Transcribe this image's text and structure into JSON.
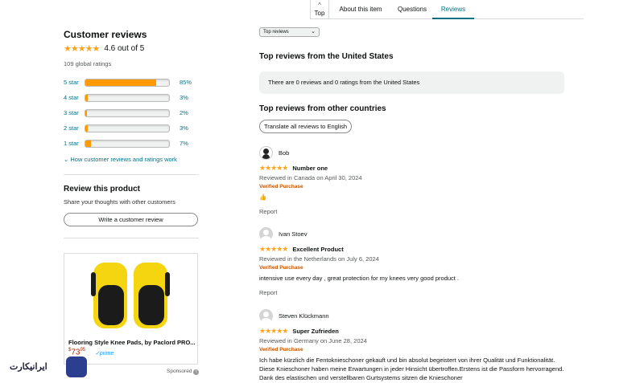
{
  "nav": {
    "top_arrow": "^",
    "top_label": "Top",
    "about": "About this item",
    "questions": "Questions",
    "reviews": "Reviews",
    "active_color": "#007185"
  },
  "summary": {
    "title": "Customer reviews",
    "stars_display": "★★★★★",
    "rating_text": "4.6 out of 5",
    "rating_value": 4.6,
    "global_ratings": "109 global ratings",
    "histogram": [
      {
        "label": "5 star",
        "pct": "85%",
        "value": 85
      },
      {
        "label": "4 star",
        "pct": "3%",
        "value": 3
      },
      {
        "label": "3 star",
        "pct": "2%",
        "value": 2
      },
      {
        "label": "2 star",
        "pct": "3%",
        "value": 3
      },
      {
        "label": "1 star",
        "pct": "7%",
        "value": 7
      }
    ],
    "how_link": "How customer reviews and ratings work",
    "bar_color": "#ff9a00"
  },
  "review_product": {
    "title": "Review this product",
    "subtitle": "Share your thoughts with other customers",
    "button": "Write a customer review"
  },
  "ad": {
    "title": "Flooring Style Knee Pads, by Paclord PRO...",
    "price_symbol": "$",
    "price_whole": "73",
    "price_fraction": "95",
    "prime": "prime",
    "sponsored": "Sponsored",
    "info": "i"
  },
  "watermark": {
    "text": "ایرانیکارت"
  },
  "reviews_panel": {
    "sort_label": "Top reviews",
    "us_title": "Top reviews from the United States",
    "us_notice": "There are 0 reviews and 0 ratings from the United States",
    "other_title": "Top reviews from other countries",
    "translate_button": "Translate all reviews to English"
  },
  "reviews": [
    {
      "name": "Bob",
      "stars": "★★★★★",
      "title": "Number one",
      "meta": "Reviewed in Canada on April 30, 2024",
      "verified": "Verified Purchase",
      "body": "👍",
      "report": "Report"
    },
    {
      "name": "Ivan Stoev",
      "stars": "★★★★★",
      "title": "Excellent Product",
      "meta": "Reviewed in the Netherlands on July 6, 2024",
      "verified": "Verified Purchase",
      "body": "intensive use every day , great protection for my knees very good product .",
      "report": "Report"
    },
    {
      "name": "Steven Klückmann",
      "stars": "★★★★★",
      "title": "Super Zufrieden",
      "meta": "Reviewed in Germany on June 28, 2024",
      "verified": "Verified Purchase",
      "body": "Ich habe kürzlich die Fentoknieschoner gekauft und bin absolut begeistert von ihrer Qualität und Funktionalität. Diese Knieschoner haben meine Erwartungen in jeder Hinsicht übertroffen.Erstens ist die Passform hervorragend. Dank des elastischen und verstellbaren Gurtsystems sitzen die Knieschoner"
    }
  ]
}
